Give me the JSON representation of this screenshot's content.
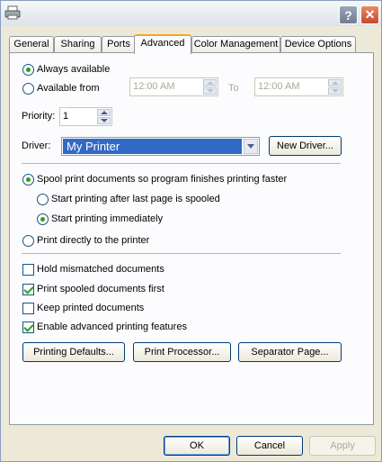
{
  "window": {
    "title": ""
  },
  "tabs": [
    {
      "label": "General"
    },
    {
      "label": "Sharing"
    },
    {
      "label": "Ports"
    },
    {
      "label": "Advanced"
    },
    {
      "label": "Color Management"
    },
    {
      "label": "Device Options"
    }
  ],
  "availability": {
    "always_label": "Always available",
    "from_label": "Available from",
    "from_time": "12:00 AM",
    "to_label": "To",
    "to_time": "12:00 AM"
  },
  "priority": {
    "label": "Priority:",
    "value": "1"
  },
  "driver": {
    "label": "Driver:",
    "value": "My Printer",
    "new_button": "New Driver..."
  },
  "spool": {
    "spool_label": "Spool print documents so program finishes printing faster",
    "after_last_label": "Start printing after last page is spooled",
    "immediately_label": "Start printing immediately",
    "direct_label": "Print directly to the printer"
  },
  "options": {
    "hold_mismatched": "Hold mismatched documents",
    "print_spooled_first": "Print spooled documents first",
    "keep_printed": "Keep printed documents",
    "enable_advanced": "Enable advanced printing features"
  },
  "panel_buttons": {
    "defaults": "Printing Defaults...",
    "processor": "Print Processor...",
    "separator": "Separator Page..."
  },
  "footer": {
    "ok": "OK",
    "cancel": "Cancel",
    "apply": "Apply"
  }
}
